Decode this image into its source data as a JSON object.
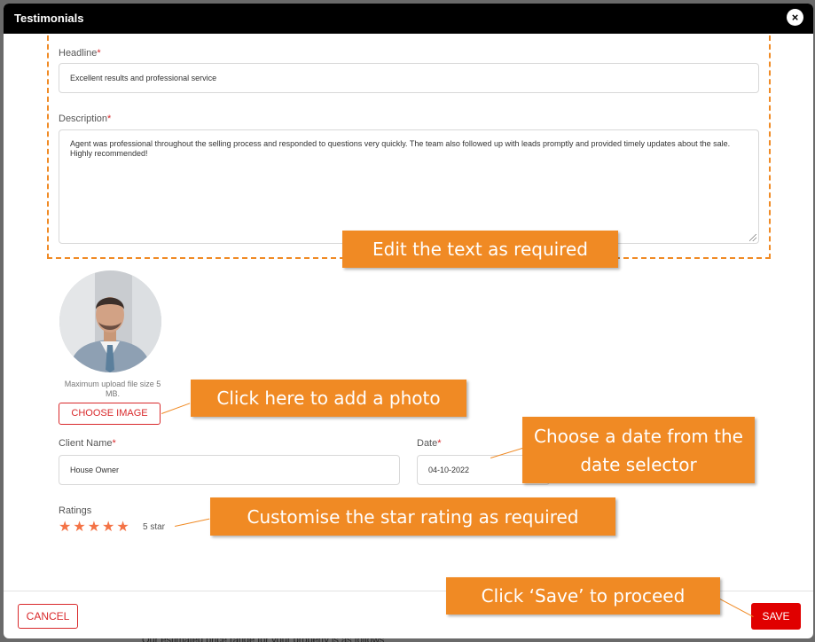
{
  "modal": {
    "title": "Testimonials",
    "close_icon": "×"
  },
  "headline": {
    "label": "Headline",
    "required_mark": "*",
    "value": "Excellent results and professional service"
  },
  "description": {
    "label": "Description",
    "required_mark": "*",
    "value": "Agent was professional throughout the selling process and responded to questions very quickly. The team also followed up with leads promptly and provided timely updates about the sale. Highly recommended!"
  },
  "photo": {
    "upload_note": "Maximum upload file size 5 MB.",
    "choose_image_label": "CHOOSE IMAGE"
  },
  "client_name": {
    "label": "Client Name",
    "required_mark": "*",
    "value": "House Owner"
  },
  "date": {
    "label": "Date",
    "required_mark": "*",
    "value": "04-10-2022"
  },
  "ratings": {
    "label": "Ratings",
    "value": 5,
    "max": 5,
    "text": "5 star",
    "star_glyph": "★"
  },
  "footer": {
    "cancel_label": "CANCEL",
    "save_label": "SAVE"
  },
  "background_peek": "Our estimated price range for your property is as follows",
  "callouts": {
    "edit_text": "Edit the text as required",
    "add_photo": "Click here to add a photo",
    "choose_date": "Choose a date from the date selector",
    "star_rating": "Customise the star rating as required",
    "save": "Click ‘Save’ to proceed"
  },
  "colors": {
    "accent": "#f08a24",
    "danger": "#d9292b",
    "save": "#e00000",
    "star": "#f47346"
  }
}
